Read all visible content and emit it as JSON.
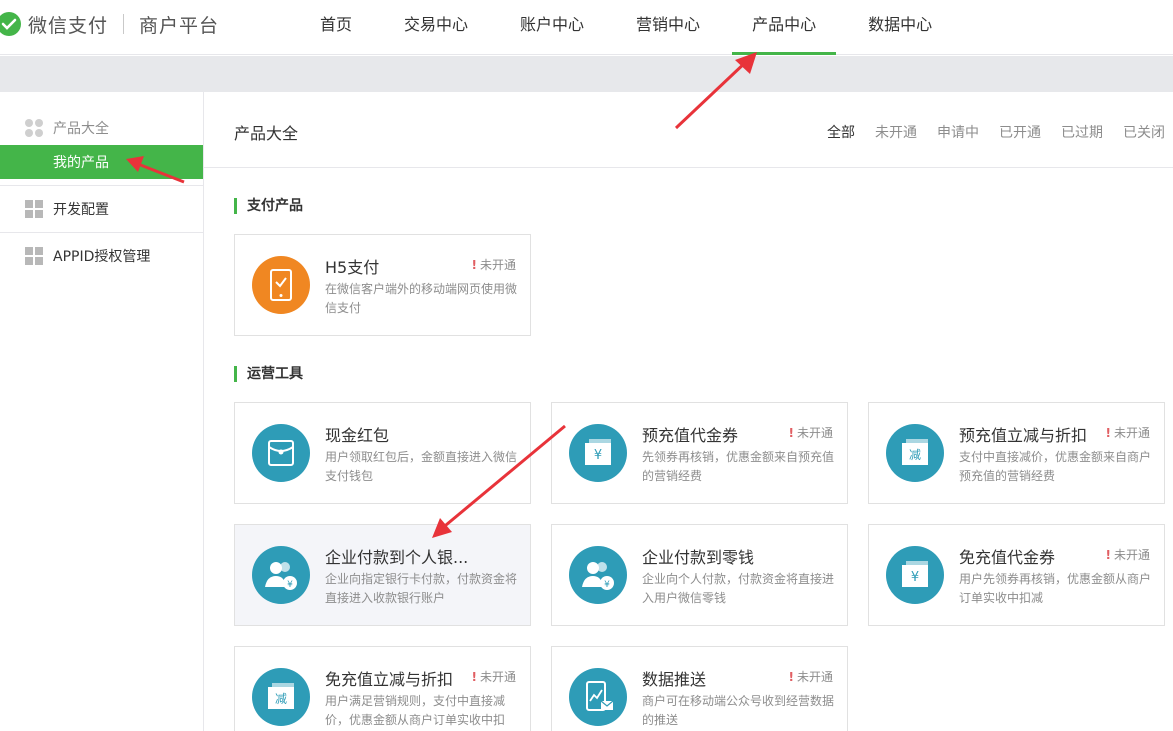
{
  "app": {
    "logo_text": "微信支付",
    "logo_sub": "商户平台"
  },
  "nav": [
    "首页",
    "交易中心",
    "账户中心",
    "营销中心",
    "产品中心",
    "数据中心"
  ],
  "sidebar": {
    "group_title": "产品大全",
    "active_item": "我的产品",
    "items": [
      "开发配置",
      "APPID授权管理"
    ]
  },
  "main": {
    "title": "产品大全",
    "filters": [
      "全部",
      "未开通",
      "申请中",
      "已开通",
      "已过期",
      "已关闭"
    ]
  },
  "sections": [
    {
      "title": "支付产品",
      "cards": [
        {
          "name": "H5支付",
          "status": "未开通",
          "desc": "在微信客户端外的移动端网页使用微信支付",
          "icon": "phone-check-icon",
          "color": "#f08722"
        }
      ]
    },
    {
      "title": "运营工具",
      "cards": [
        {
          "name": "现金红包",
          "status": "",
          "desc": "用户领取红包后，金额直接进入微信支付钱包",
          "icon": "red-packet-icon",
          "color": "#2e9cb7"
        },
        {
          "name": "预充值代金券",
          "status": "未开通",
          "desc": "先领券再核销，优惠金额来自预充值的营销经费",
          "icon": "yuan-coupon-icon",
          "color": "#2e9cb7"
        },
        {
          "name": "预充值立减与折扣",
          "status": "未开通",
          "desc": "支付中直接减价，优惠金额来自商户预充值的营销经费",
          "icon": "discount-coupon-icon",
          "color": "#2e9cb7"
        },
        {
          "name": "企业付款到个人银...",
          "status": "",
          "desc": "企业向指定银行卡付款，付款资金将直接进入收款银行账户",
          "icon": "users-yuan-icon",
          "color": "#2e9cb7"
        },
        {
          "name": "企业付款到零钱",
          "status": "",
          "desc": "企业向个人付款，付款资金将直接进入用户微信零钱",
          "icon": "users-yuan-icon",
          "color": "#2e9cb7"
        },
        {
          "name": "免充值代金券",
          "status": "未开通",
          "desc": "用户先领券再核销，优惠金额从商户订单实收中扣减",
          "icon": "yuan-coupon-icon",
          "color": "#2e9cb7"
        },
        {
          "name": "免充值立减与折扣",
          "status": "未开通",
          "desc": "用户满足营销规则，支付中直接减价，优惠金额从商户订单实收中扣",
          "icon": "discount-coupon-icon",
          "color": "#2e9cb7"
        },
        {
          "name": "数据推送",
          "status": "未开通",
          "desc": "商户可在移动端公众号收到经营数据的推送",
          "icon": "chart-mail-icon",
          "color": "#2e9cb7"
        }
      ]
    }
  ],
  "coupon_glyphs": {
    "yuan": "¥",
    "discount": "减"
  }
}
